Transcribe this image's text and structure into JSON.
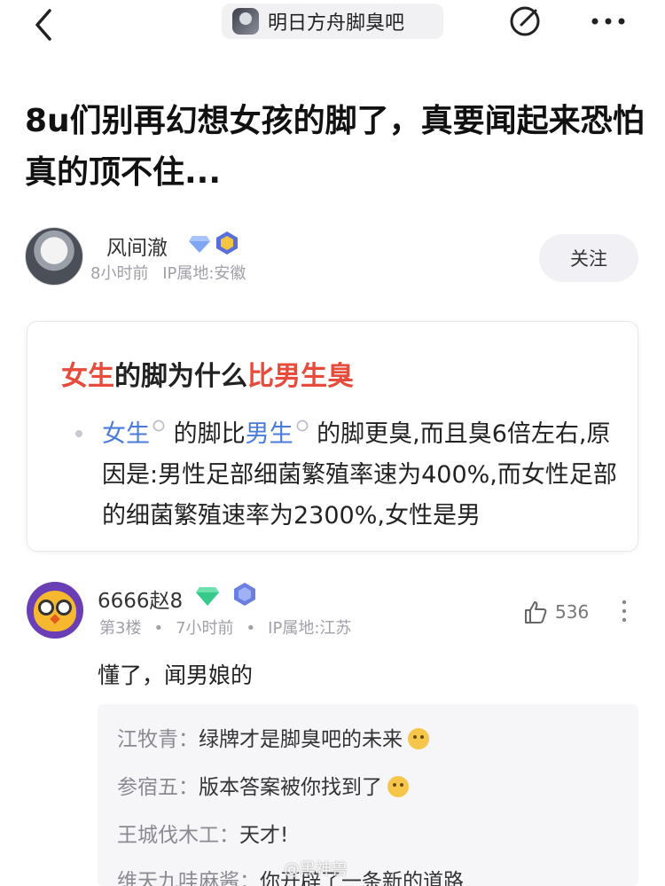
{
  "topbar": {
    "forum_name": "明日方舟脚臭吧"
  },
  "post": {
    "title": "8u们别再幻想女孩的脚了，真要闻起来恐怕真的顶不住..."
  },
  "author": {
    "name": "风间澈",
    "time": "8小时前",
    "ip": "IP属地:安徽",
    "follow_label": "关注"
  },
  "card": {
    "title_part1": "女生",
    "title_part2": "的脚为什么",
    "title_part3": "比男生臭",
    "body_term1": "女生",
    "body_text1": " 的脚比",
    "body_term2": "男生",
    "body_text2": " 的脚更臭,而且臭6倍左右,原因是:男性足部细菌繁殖率速为400%,而女性足部的细菌繁殖速率为2300%,女性是男"
  },
  "comment": {
    "name": "6666赵8",
    "floor": "第3楼",
    "time": "7小时前",
    "ip": "IP属地:江苏",
    "likes": "536",
    "text": "懂了，闻男娘的"
  },
  "replies": [
    {
      "name": "江牧青：",
      "text": "绿牌才是脚臭吧的未来",
      "emoji": "thumbs-up-emoji"
    },
    {
      "name": "参宿五：",
      "text": "版本答案被你找到了",
      "emoji": "grin-emoji"
    },
    {
      "name": "王城伐木工：",
      "text": "天才!",
      "emoji": ""
    },
    {
      "name": "维天九哇麻酱：",
      "text": "你开辟了一条新的道路",
      "emoji": ""
    }
  ],
  "watermark": "@黑神兽",
  "colors": {
    "accent_red": "#e64b3b",
    "link_blue": "#4a7bd9"
  }
}
